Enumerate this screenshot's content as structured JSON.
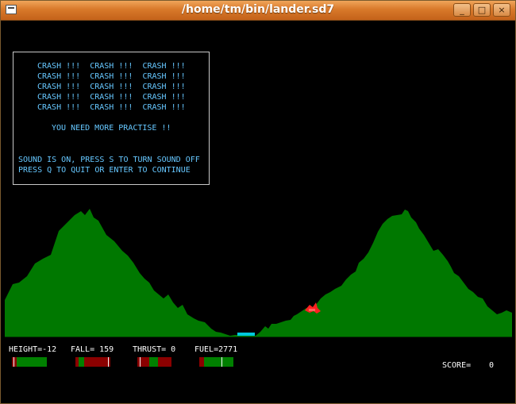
{
  "window": {
    "title": "/home/tm/bin/lander.sd7",
    "buttons": {
      "minimize": "_",
      "maximize": "□",
      "close": "×"
    }
  },
  "message": {
    "crash_lines": [
      "CRASH !!!  CRASH !!!  CRASH !!!",
      "CRASH !!!  CRASH !!!  CRASH !!!",
      "CRASH !!!  CRASH !!!  CRASH !!!",
      "CRASH !!!  CRASH !!!  CRASH !!!",
      "CRASH !!!  CRASH !!!  CRASH !!!"
    ],
    "practise": "YOU NEED MORE PRACTISE !!",
    "sound_line": "SOUND IS ON, PRESS S TO TURN SOUND OFF",
    "quit_line": "PRESS Q TO QUIT OR ENTER TO CONTINUE"
  },
  "hud": {
    "height_label": "HEIGHT=-12",
    "fall_label": "FALL= 159",
    "thrust_label": "THRUST= 0",
    "fuel_label": "FUEL=2771",
    "score_label": "SCORE=",
    "score_value": "0"
  },
  "colors": {
    "terrain": "#007800",
    "pad": "#00c8dc",
    "text": "#66c7ff",
    "gauge_red": "#8b0000",
    "gauge_green": "#008000",
    "lander": "#ff2020"
  }
}
